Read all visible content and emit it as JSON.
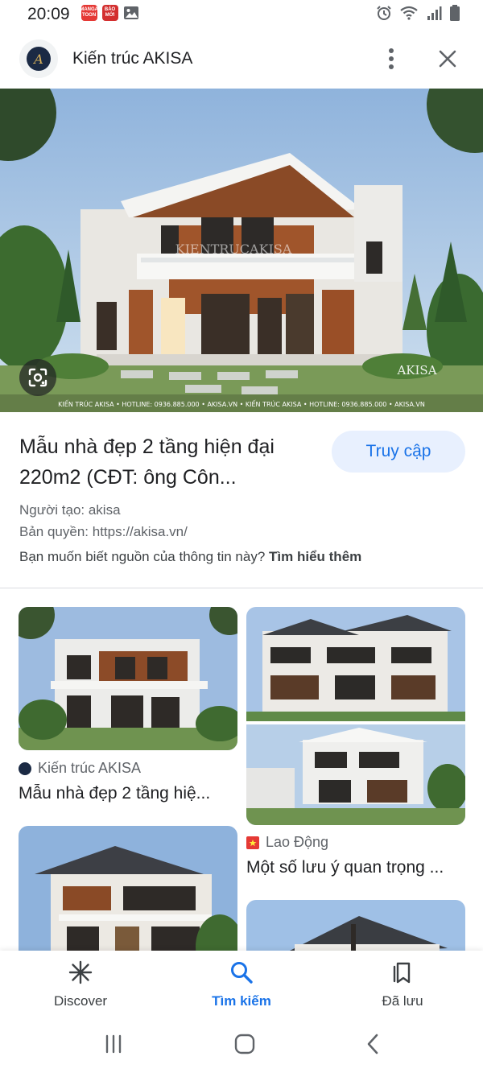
{
  "status_bar": {
    "time": "20:09",
    "badges": [
      {
        "text": "MANGA TOON",
        "color": "#e53935"
      },
      {
        "text": "BÁO MỚI",
        "color": "#e53935"
      }
    ],
    "icons": [
      "image-icon",
      "alarm-icon",
      "wifi-icon",
      "signal-icon",
      "battery-icon"
    ]
  },
  "header": {
    "logo_text": "A",
    "title": "Kiến trúc AKISA",
    "menu_icon": "more-vert-icon",
    "close_icon": "close-icon"
  },
  "hero": {
    "watermark": "KIENTRUCAKISA",
    "brand": "AKISA",
    "footer_strip": "KIẾN TRÚC AKISA  •  HOTLINE: 0936.885.000  •  AKISA.VN  •  KIẾN TRÚC AKISA  •  HOTLINE: 0936.885.000  •  AKISA.VN",
    "lens_icon": "google-lens-icon"
  },
  "result": {
    "title": "Mẫu nhà đẹp 2 tầng hiện đại 220m2 (CĐT: ông Côn...",
    "visit_label": "Truy cập",
    "creator": "Người tạo: akisa",
    "copyright": "Bản quyền: https://akisa.vn/",
    "source_question": "Bạn muốn biết nguồn của thông tin này?",
    "learn_more": "Tìm hiểu thêm"
  },
  "related": [
    {
      "source": "Kiến trúc AKISA",
      "title": "Mẫu nhà đẹp 2 tầng hiệ..."
    },
    {
      "source": "Lao Động",
      "title": "Một số lưu ý quan trọng ..."
    }
  ],
  "bottom_nav": [
    {
      "label": "Discover",
      "icon": "discover-asterisk-icon",
      "active": false
    },
    {
      "label": "Tìm kiếm",
      "icon": "search-icon",
      "active": true
    },
    {
      "label": "Đã lưu",
      "icon": "saved-bookmarks-icon",
      "active": false
    }
  ],
  "colors": {
    "accent": "#1a73e8",
    "visit_bg": "#e8f0fe",
    "secondary_text": "#5f6368"
  }
}
